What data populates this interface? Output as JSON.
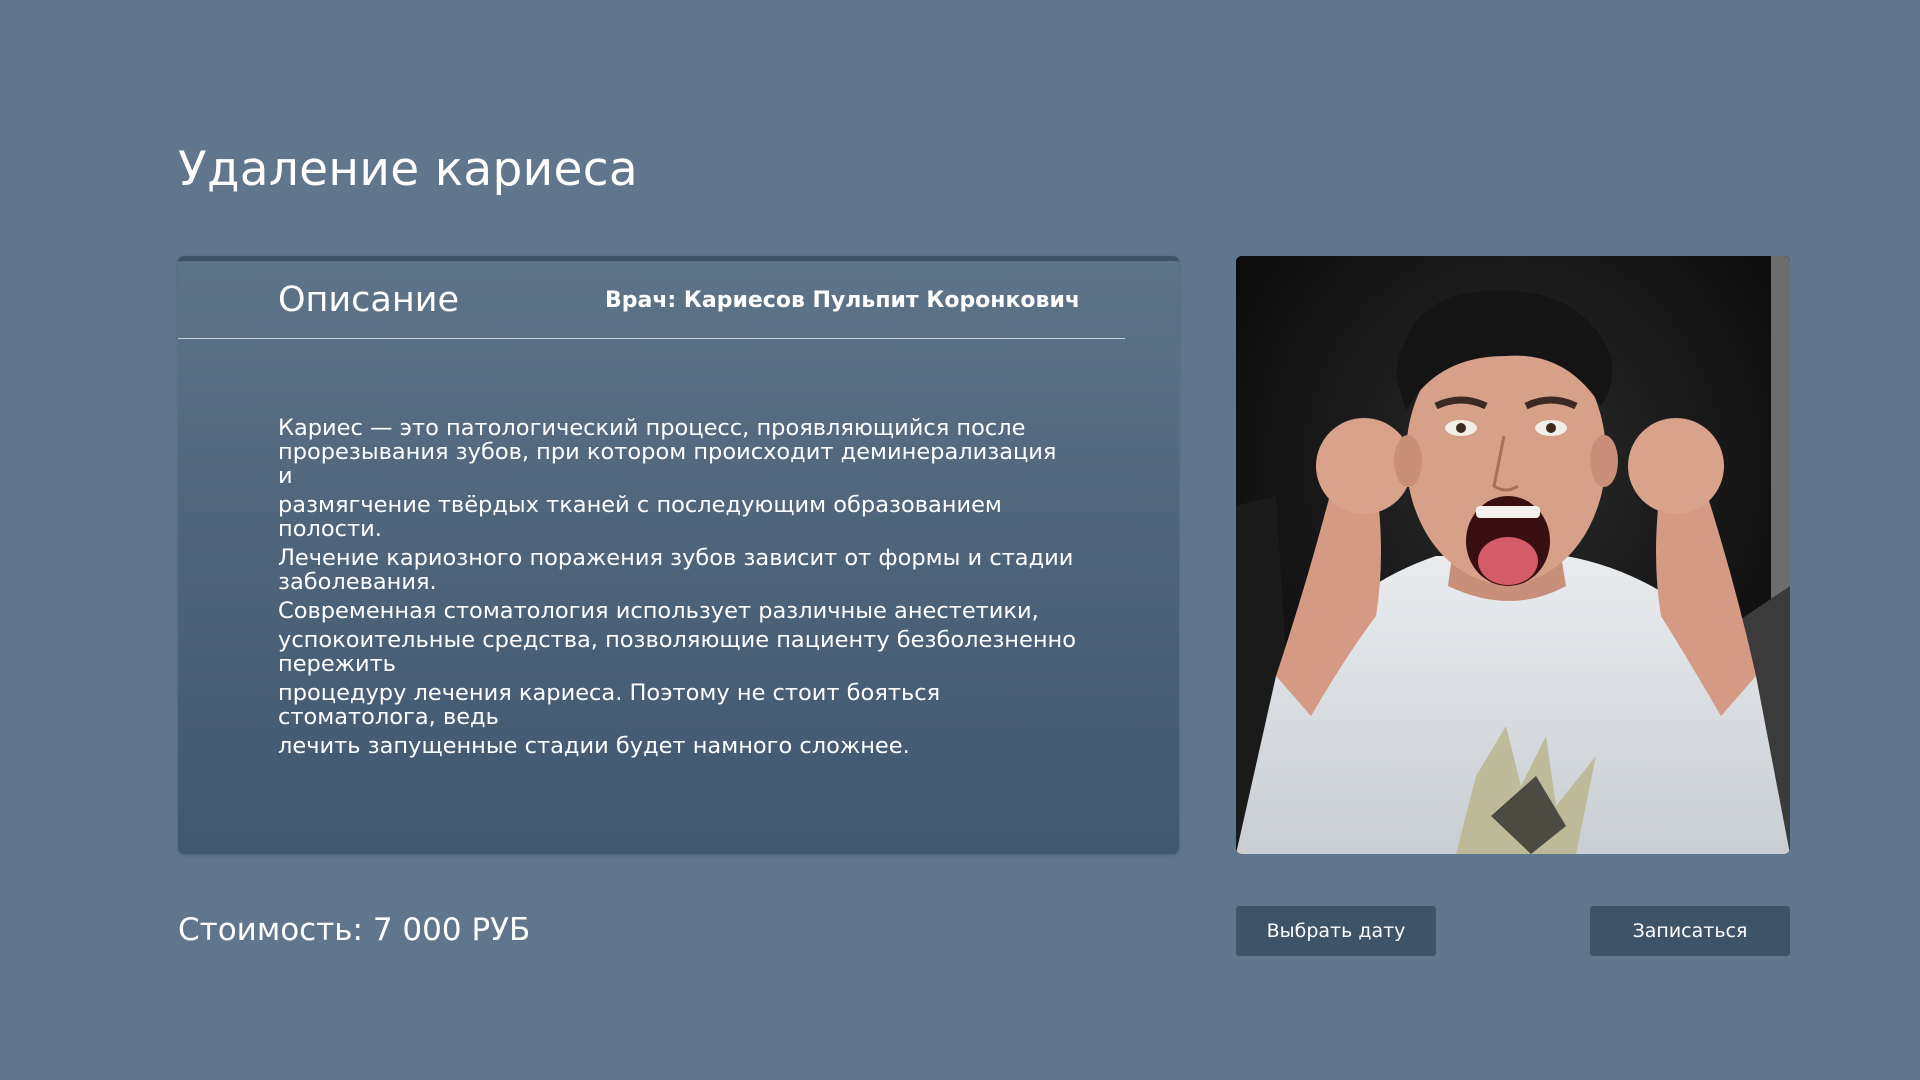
{
  "page": {
    "title": "Удаление кариеса"
  },
  "description_card": {
    "heading": "Описание",
    "doctor_label": "Врач:",
    "doctor_name": "Кариесов Пульпит Коронкович",
    "lines": [
      "Кариес — это патологический процесс, проявляющийся после прорезывания зубов, при котором происходит деминерализация и",
      "размягчение твёрдых тканей с последующим образованием полости.",
      "Лечение кариозного поражения зубов зависит от формы и стадии заболевания.",
      "Современная стоматология использует различные анестетики,",
      "успокоительные средства, позволяющие пациенту безболезненно пережить",
      "процедуру лечения кариеса. Поэтому не стоит бояться стоматолога, ведь",
      "лечить запущенные стадии будет намного сложнее."
    ]
  },
  "price": {
    "label": "Стоимость:",
    "value": "7 000 РУБ"
  },
  "buttons": {
    "choose_date": "Выбрать дату",
    "book": "Записаться"
  },
  "colors": {
    "background": "#5f768c",
    "button": "#3d5368",
    "card_bottom": "#405870"
  },
  "icons": {
    "photo": "doctor-photo-image"
  }
}
